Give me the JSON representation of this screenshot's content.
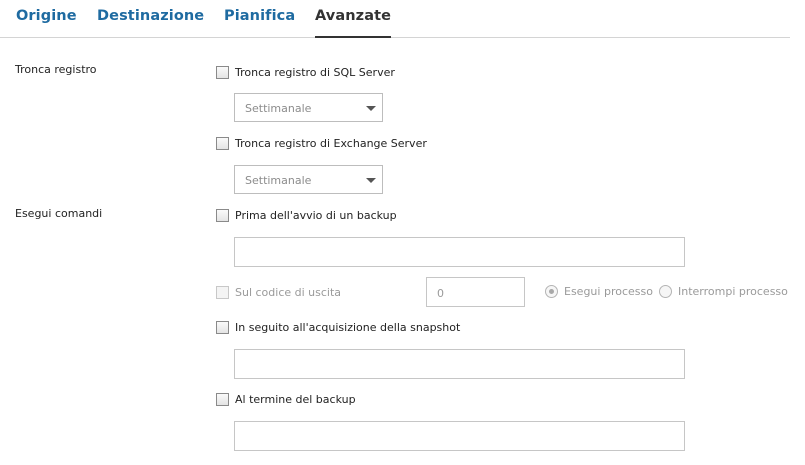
{
  "tabs": [
    {
      "label": "Origine"
    },
    {
      "label": "Destinazione"
    },
    {
      "label": "Pianifica"
    },
    {
      "label": "Avanzate",
      "active": true
    }
  ],
  "truncate": {
    "section_label": "Tronca registro",
    "sql_label": "Tronca registro di SQL Server",
    "sql_frequency": "Settimanale",
    "exchange_label": "Tronca registro di Exchange Server",
    "exchange_frequency": "Settimanale"
  },
  "commands": {
    "section_label": "Esegui comandi",
    "before_backup_label": "Prima dell'avvio di un backup",
    "before_backup_value": "",
    "exit_code_label": "Sul codice di uscita",
    "exit_code_value": "0",
    "run_process_label": "Esegui processo",
    "abort_process_label": "Interrompi processo",
    "after_snapshot_label": "In seguito all'acquisizione della snapshot",
    "after_snapshot_value": "",
    "after_backup_label": "Al termine del backup",
    "after_backup_value": ""
  },
  "colors": {
    "tab_link": "#1f6ba1",
    "tab_active": "#333333"
  }
}
